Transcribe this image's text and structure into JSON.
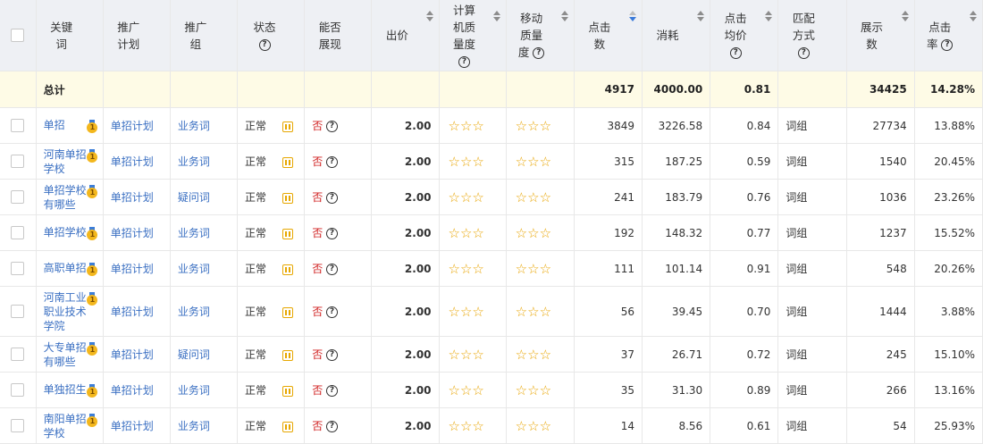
{
  "headers": {
    "keyword": "关键词",
    "plan": "推广计划",
    "group": "推广组",
    "status": "状态",
    "can_show": "能否展现",
    "bid": "出价",
    "pc_quality": "计算机质量度",
    "mobile_quality": "移动质量度",
    "clicks": "点击数",
    "cost": "消耗",
    "avg_cpc": "点击均价",
    "match": "匹配方式",
    "impressions": "展示数",
    "ctr": "点击率"
  },
  "total": {
    "label": "总计",
    "clicks": "4917",
    "cost": "4000.00",
    "avg_cpc": "0.81",
    "impressions": "34425",
    "ctr": "14.28%"
  },
  "rows": [
    {
      "keyword": "单招",
      "plan": "单招计划",
      "group": "业务词",
      "status": "正常",
      "can_show": "否",
      "bid": "2.00",
      "pc_stars": "☆☆☆",
      "mobile_stars": "☆☆☆",
      "clicks": "3849",
      "cost": "3226.58",
      "avg_cpc": "0.84",
      "match": "词组",
      "impressions": "27734",
      "ctr": "13.88%"
    },
    {
      "keyword": "河南单招学校",
      "plan": "单招计划",
      "group": "业务词",
      "status": "正常",
      "can_show": "否",
      "bid": "2.00",
      "pc_stars": "☆☆☆",
      "mobile_stars": "☆☆☆",
      "clicks": "315",
      "cost": "187.25",
      "avg_cpc": "0.59",
      "match": "词组",
      "impressions": "1540",
      "ctr": "20.45%"
    },
    {
      "keyword": "单招学校有哪些",
      "plan": "单招计划",
      "group": "疑问词",
      "status": "正常",
      "can_show": "否",
      "bid": "2.00",
      "pc_stars": "☆☆☆",
      "mobile_stars": "☆☆☆",
      "clicks": "241",
      "cost": "183.79",
      "avg_cpc": "0.76",
      "match": "词组",
      "impressions": "1036",
      "ctr": "23.26%"
    },
    {
      "keyword": "单招学校",
      "plan": "单招计划",
      "group": "业务词",
      "status": "正常",
      "can_show": "否",
      "bid": "2.00",
      "pc_stars": "☆☆☆",
      "mobile_stars": "☆☆☆",
      "clicks": "192",
      "cost": "148.32",
      "avg_cpc": "0.77",
      "match": "词组",
      "impressions": "1237",
      "ctr": "15.52%"
    },
    {
      "keyword": "高职单招",
      "plan": "单招计划",
      "group": "业务词",
      "status": "正常",
      "can_show": "否",
      "bid": "2.00",
      "pc_stars": "☆☆☆",
      "mobile_stars": "☆☆☆",
      "clicks": "111",
      "cost": "101.14",
      "avg_cpc": "0.91",
      "match": "词组",
      "impressions": "548",
      "ctr": "20.26%"
    },
    {
      "keyword": "河南工业职业技术学院",
      "plan": "单招计划",
      "group": "业务词",
      "status": "正常",
      "can_show": "否",
      "bid": "2.00",
      "pc_stars": "☆☆☆",
      "mobile_stars": "☆☆☆",
      "clicks": "56",
      "cost": "39.45",
      "avg_cpc": "0.70",
      "match": "词组",
      "impressions": "1444",
      "ctr": "3.88%"
    },
    {
      "keyword": "大专单招有哪些",
      "plan": "单招计划",
      "group": "疑问词",
      "status": "正常",
      "can_show": "否",
      "bid": "2.00",
      "pc_stars": "☆☆☆",
      "mobile_stars": "☆☆☆",
      "clicks": "37",
      "cost": "26.71",
      "avg_cpc": "0.72",
      "match": "词组",
      "impressions": "245",
      "ctr": "15.10%"
    },
    {
      "keyword": "单独招生",
      "plan": "单招计划",
      "group": "业务词",
      "status": "正常",
      "can_show": "否",
      "bid": "2.00",
      "pc_stars": "☆☆☆",
      "mobile_stars": "☆☆☆",
      "clicks": "35",
      "cost": "31.30",
      "avg_cpc": "0.89",
      "match": "词组",
      "impressions": "266",
      "ctr": "13.16%"
    },
    {
      "keyword": "南阳单招学校",
      "plan": "单招计划",
      "group": "业务词",
      "status": "正常",
      "can_show": "否",
      "bid": "2.00",
      "pc_stars": "☆☆☆",
      "mobile_stars": "☆☆☆",
      "clicks": "14",
      "cost": "8.56",
      "avg_cpc": "0.61",
      "match": "词组",
      "impressions": "54",
      "ctr": "25.93%"
    }
  ]
}
